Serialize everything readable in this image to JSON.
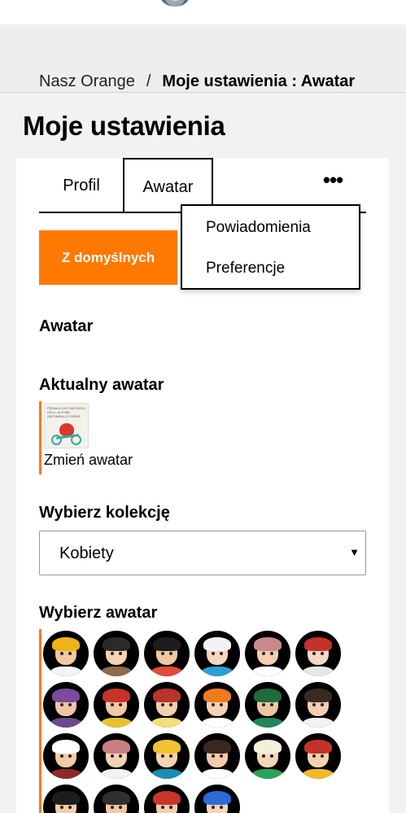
{
  "breadcrumb": {
    "link": "Nasz Orange",
    "separator": "/",
    "current": "Moje ustawienia : Awatar"
  },
  "page_title": "Moje ustawienia",
  "tabs": [
    {
      "label": "Profil"
    },
    {
      "label": "Awatar",
      "active": true
    }
  ],
  "more_tabs_label": "•••",
  "more_menu": [
    {
      "label": "Powiadomienia"
    },
    {
      "label": "Preferencje"
    }
  ],
  "default_button": "Z domyślnych",
  "section_avatar": "Awatar",
  "current_avatar": {
    "label": "Aktualny awatar",
    "change_link": "Zmień awatar",
    "thumb_caption": "PEDAŁUJ DO SWOJEGO CELU, ALE NIE ZAPOMINAJ O SOBIE"
  },
  "collection": {
    "label": "Wybierz kolekcję",
    "selected": "Kobiety",
    "arrow": "▼"
  },
  "choose_avatar": {
    "label": "Wybierz awatar",
    "avatars": [
      {
        "name": "avatar-1",
        "skin": "#f2c9a0",
        "hair": "#f0b21a",
        "body": "#f4f4f4"
      },
      {
        "name": "avatar-2",
        "skin": "#f5d3b3",
        "hair": "#2a2a2a",
        "body": "#8c6b4f"
      },
      {
        "name": "avatar-3",
        "skin": "#f1c7a4",
        "hair": "#1d1d1d",
        "body": "#e04b3a"
      },
      {
        "name": "avatar-4",
        "skin": "#f6d7c0",
        "hair": "#f2f2f2",
        "body": "#2e9fd1"
      },
      {
        "name": "avatar-5",
        "skin": "#f4cdb2",
        "hair": "#c98a8a",
        "body": "#ffffff"
      },
      {
        "name": "avatar-6",
        "skin": "#f6d8c4",
        "hair": "#c4322b",
        "body": "#e7e7e7"
      },
      {
        "name": "avatar-7",
        "skin": "#f2c4a6",
        "hair": "#7a4a9c",
        "body": "#6a4a8a"
      },
      {
        "name": "avatar-8",
        "skin": "#f3c9a6",
        "hair": "#c8322a",
        "body": "#e7c132"
      },
      {
        "name": "avatar-9",
        "skin": "#f3d0ae",
        "hair": "#b8342c",
        "body": "#f1e07a"
      },
      {
        "name": "avatar-10",
        "skin": "#f6d2b6",
        "hair": "#f07a1e",
        "body": "#ffffff"
      },
      {
        "name": "avatar-11",
        "skin": "#f0c5a4",
        "hair": "#1f6b3c",
        "body": "#23865a"
      },
      {
        "name": "avatar-12",
        "skin": "#f3cdb0",
        "hair": "#3a2a22",
        "body": "#f2f2f2"
      },
      {
        "name": "avatar-13",
        "skin": "#f4cba8",
        "hair": "#ffffff",
        "body": "#8a2a2a"
      },
      {
        "name": "avatar-14",
        "skin": "#f5d2b5",
        "hair": "#c98080",
        "body": "#f2f2f2"
      },
      {
        "name": "avatar-15",
        "skin": "#f6d3b1",
        "hair": "#f1c232",
        "body": "#1b8db5"
      },
      {
        "name": "avatar-16",
        "skin": "#f3cbab",
        "hair": "#3a2820",
        "body": "#ffffff"
      },
      {
        "name": "avatar-17",
        "skin": "#f5d6bb",
        "hair": "#f4efd9",
        "body": "#2aa35a"
      },
      {
        "name": "avatar-18",
        "skin": "#f6d3b0",
        "hair": "#c3332b",
        "body": "#f1b82e"
      },
      {
        "name": "avatar-19",
        "skin": "#f4ccaa",
        "hair": "#1d1d1d",
        "body": "#cc2a2a"
      },
      {
        "name": "avatar-20",
        "skin": "#f1c7a6",
        "hair": "#2f2f2f",
        "body": "#2a6aa3"
      },
      {
        "name": "avatar-21",
        "skin": "#f4ceb0",
        "hair": "#c9342c",
        "body": "#ffffff"
      },
      {
        "name": "avatar-22",
        "skin": "#f5d4b8",
        "hair": "#2d6ad6",
        "body": "#f3b12c"
      }
    ]
  },
  "colors": {
    "accent": "#ff7900",
    "page_bg": "#f2f2f2",
    "card_bg": "#ffffff"
  }
}
